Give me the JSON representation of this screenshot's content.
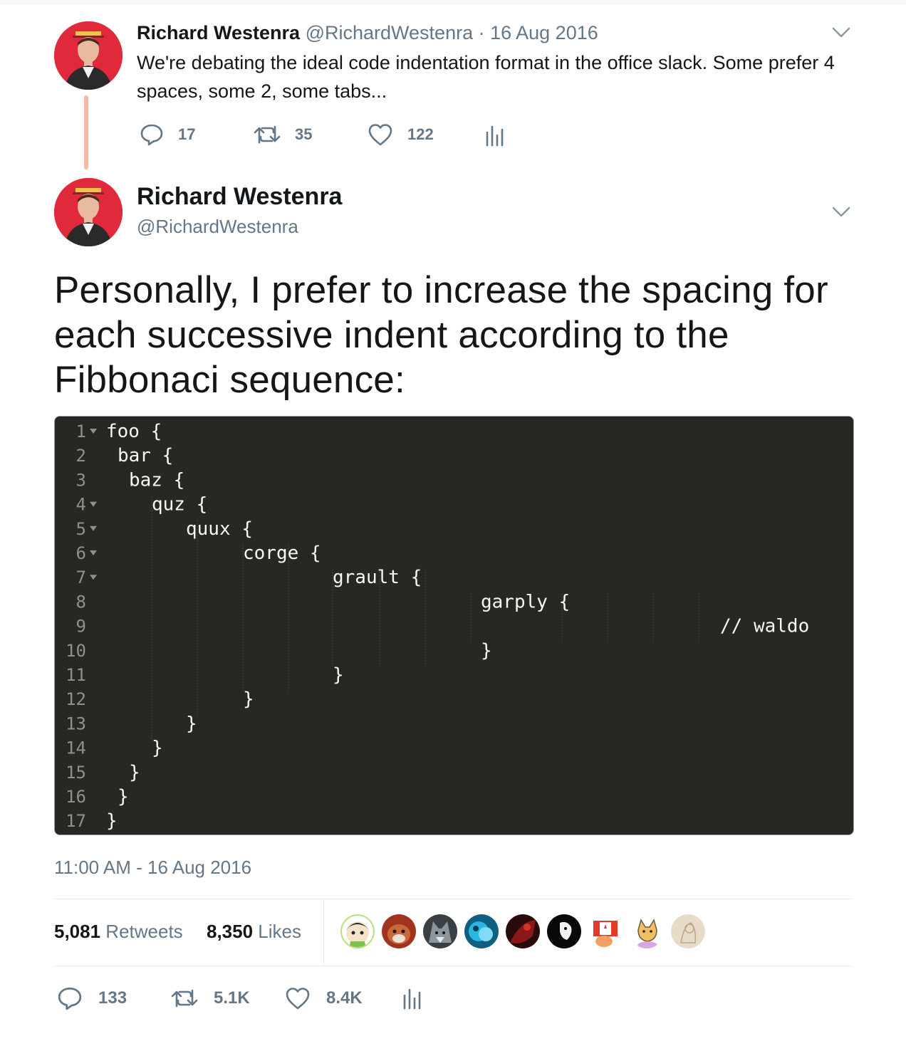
{
  "reply_tweet": {
    "name": "Richard Westenra",
    "handle": "@RichardWestenra",
    "separator": " · ",
    "date": "16 Aug 2016",
    "text": "We're debating the ideal code indentation format in the office slack. Some prefer 4 spaces, some 2, some tabs...",
    "actions": {
      "replies": "17",
      "retweets": "35",
      "likes": "122"
    }
  },
  "main_tweet": {
    "name": "Richard Westenra",
    "handle": "@RichardWestenra",
    "text": "Personally, I prefer to increase the spacing for each successive indent according to the Fibbonaci sequence:",
    "code": {
      "lines": [
        {
          "num": "1",
          "fold": true,
          "text": "foo {"
        },
        {
          "num": "2",
          "fold": false,
          "text": "bar {"
        },
        {
          "num": "3",
          "fold": false,
          "text": "baz {"
        },
        {
          "num": "4",
          "fold": true,
          "text": "quz {"
        },
        {
          "num": "5",
          "fold": true,
          "text": "quux {"
        },
        {
          "num": "6",
          "fold": true,
          "text": "corge {"
        },
        {
          "num": "7",
          "fold": true,
          "text": "grault {"
        },
        {
          "num": "8",
          "fold": false,
          "text": "garply {"
        },
        {
          "num": "9",
          "fold": false,
          "text": "// waldo"
        },
        {
          "num": "10",
          "fold": false,
          "text": "}"
        },
        {
          "num": "11",
          "fold": false,
          "text": "}"
        },
        {
          "num": "12",
          "fold": false,
          "text": "}"
        },
        {
          "num": "13",
          "fold": false,
          "text": "}"
        },
        {
          "num": "14",
          "fold": false,
          "text": "}"
        },
        {
          "num": "15",
          "fold": false,
          "text": "}"
        },
        {
          "num": "16",
          "fold": false,
          "text": "}"
        },
        {
          "num": "17",
          "fold": false,
          "text": "}"
        }
      ],
      "colors": {
        "background": "#272822",
        "text": "#f8f8f2",
        "gutter": "#90908a",
        "guides": "#464741"
      }
    },
    "timestamp": "11:00 AM - 16 Aug 2016",
    "stats": {
      "retweets_count": "5,081",
      "retweets_label": " Retweets",
      "likes_count": "8,350",
      "likes_label": " Likes"
    },
    "likers": [
      {
        "icon": "avatar-cartoon-green"
      },
      {
        "icon": "avatar-fox-brown"
      },
      {
        "icon": "avatar-wolf-grey"
      },
      {
        "icon": "avatar-blue-cyan"
      },
      {
        "icon": "avatar-dark-red"
      },
      {
        "icon": "avatar-black-white"
      },
      {
        "icon": "avatar-canada-flag"
      },
      {
        "icon": "avatar-cat-sketch"
      },
      {
        "icon": "avatar-beige-sketch"
      }
    ],
    "actions": {
      "replies": "133",
      "retweets": "5.1K",
      "likes": "8.4K"
    }
  },
  "colors": {
    "text": "#14171a",
    "secondary": "#657786",
    "divider": "#e6ecf0",
    "thread_line": "#f7b9a6",
    "avatar_bg": "#e0293a"
  }
}
